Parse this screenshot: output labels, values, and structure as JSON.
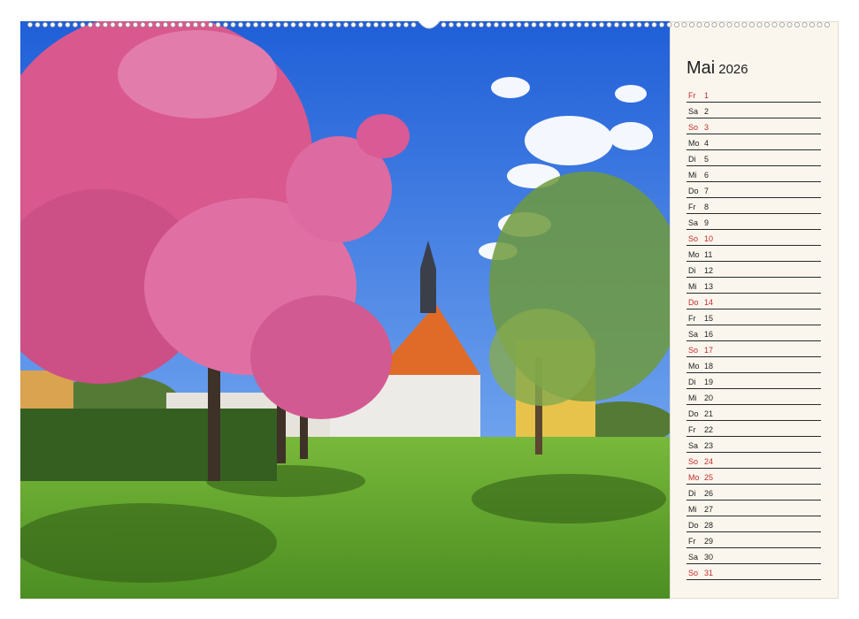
{
  "calendar": {
    "month": "Mai",
    "year": "2026",
    "days": [
      {
        "name": "Fr",
        "num": "1",
        "holiday": true
      },
      {
        "name": "Sa",
        "num": "2",
        "holiday": false
      },
      {
        "name": "So",
        "num": "3",
        "holiday": true
      },
      {
        "name": "Mo",
        "num": "4",
        "holiday": false
      },
      {
        "name": "Di",
        "num": "5",
        "holiday": false
      },
      {
        "name": "Mi",
        "num": "6",
        "holiday": false
      },
      {
        "name": "Do",
        "num": "7",
        "holiday": false
      },
      {
        "name": "Fr",
        "num": "8",
        "holiday": false
      },
      {
        "name": "Sa",
        "num": "9",
        "holiday": false
      },
      {
        "name": "So",
        "num": "10",
        "holiday": true
      },
      {
        "name": "Mo",
        "num": "11",
        "holiday": false
      },
      {
        "name": "Di",
        "num": "12",
        "holiday": false
      },
      {
        "name": "Mi",
        "num": "13",
        "holiday": false
      },
      {
        "name": "Do",
        "num": "14",
        "holiday": true
      },
      {
        "name": "Fr",
        "num": "15",
        "holiday": false
      },
      {
        "name": "Sa",
        "num": "16",
        "holiday": false
      },
      {
        "name": "So",
        "num": "17",
        "holiday": true
      },
      {
        "name": "Mo",
        "num": "18",
        "holiday": false
      },
      {
        "name": "Di",
        "num": "19",
        "holiday": false
      },
      {
        "name": "Mi",
        "num": "20",
        "holiday": false
      },
      {
        "name": "Do",
        "num": "21",
        "holiday": false
      },
      {
        "name": "Fr",
        "num": "22",
        "holiday": false
      },
      {
        "name": "Sa",
        "num": "23",
        "holiday": false
      },
      {
        "name": "So",
        "num": "24",
        "holiday": true
      },
      {
        "name": "Mo",
        "num": "25",
        "holiday": true
      },
      {
        "name": "Di",
        "num": "26",
        "holiday": false
      },
      {
        "name": "Mi",
        "num": "27",
        "holiday": false
      },
      {
        "name": "Do",
        "num": "28",
        "holiday": false
      },
      {
        "name": "Fr",
        "num": "29",
        "holiday": false
      },
      {
        "name": "Sa",
        "num": "30",
        "holiday": false
      },
      {
        "name": "So",
        "num": "31",
        "holiday": true
      }
    ]
  },
  "colors": {
    "holiday": "#c42c2c",
    "regular": "#222222",
    "panel_bg": "#faf6ee",
    "sky": "#2f6fe0",
    "blossom": "#d9588e",
    "grass": "#5aa12a"
  },
  "photo": {
    "subject_icons": [
      "cherry-blossom-tree",
      "church-tower",
      "green-tree",
      "lawn",
      "sky-clouds"
    ]
  }
}
